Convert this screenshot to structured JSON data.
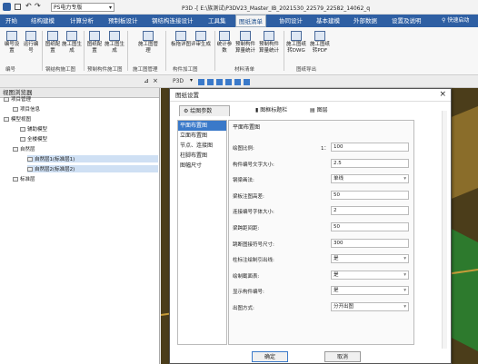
{
  "titlebar": {
    "project": "PS电力专版",
    "title": "P3D -[ E:\\族测试\\P3DV23_Master_IB_2021530_22579_22582_14062_q"
  },
  "menu": [
    "开始",
    "结构建模",
    "计算分析",
    "预制板设计",
    "钢结构连接设计",
    "工具集",
    "图纸清单",
    "协同设计",
    "基本建模",
    "外部数据",
    "设置及说明"
  ],
  "quick": "快速启动",
  "ribbon": {
    "buttons": [
      "编号设置",
      "运行编号",
      "图纸配置",
      "施工图生成",
      "图纸配置",
      "施工图生成",
      "施工图管理",
      "板拖详图",
      "评审生成",
      "统计参数",
      "预制构件算量统计",
      "预制构件算量统计",
      "施工图纸转DWG",
      "施工图纸转PDF"
    ],
    "groups": [
      "编号",
      "钢结构施工图",
      "预制构件施工图",
      "施工图管理",
      "构件加工图",
      "材料清单",
      "图纸导出"
    ]
  },
  "left": {
    "title": "视图浏览器",
    "tree": [
      "项目管理",
      "项目信息",
      "模型视图",
      "辅助模型",
      "全楼模型",
      "自然层",
      "自然层1(标准层1)",
      "自然层2(标准层2)",
      "标准层"
    ]
  },
  "dialog": {
    "title": "图纸设置",
    "close": "×",
    "tabs": [
      "绘图参数",
      "图框标题栏",
      "图层"
    ],
    "side": [
      "平面布置图",
      "立面布置图",
      "节点、连接图",
      "柱脚布置图",
      "图幅尺寸"
    ],
    "form_title": "平面布置图",
    "fields": [
      {
        "label": "绘图比例:",
        "prefix": "1：",
        "value": "100",
        "select": false
      },
      {
        "label": "构件编号文字大小:",
        "prefix": "",
        "value": "2.5",
        "select": false
      },
      {
        "label": "钢梁画法:",
        "prefix": "",
        "value": "单线",
        "select": true
      },
      {
        "label": "梁板注图高差:",
        "prefix": "",
        "value": "50",
        "select": false
      },
      {
        "label": "连接编号字体大小:",
        "prefix": "",
        "value": "2",
        "select": false
      },
      {
        "label": "梁跨距间距:",
        "prefix": "",
        "value": "50",
        "select": false
      },
      {
        "label": "跳断图接符号尺寸:",
        "prefix": "",
        "value": "300",
        "select": false
      },
      {
        "label": "柱标注绘制引出线:",
        "prefix": "",
        "value": "是",
        "select": true
      },
      {
        "label": "绘制截面表:",
        "prefix": "",
        "value": "是",
        "select": true
      },
      {
        "label": "显示构件编号:",
        "prefix": "",
        "value": "是",
        "select": true
      },
      {
        "label": "出图方式:",
        "prefix": "",
        "value": "分开出图",
        "select": true
      }
    ],
    "ok": "确定",
    "cancel": "取消"
  }
}
